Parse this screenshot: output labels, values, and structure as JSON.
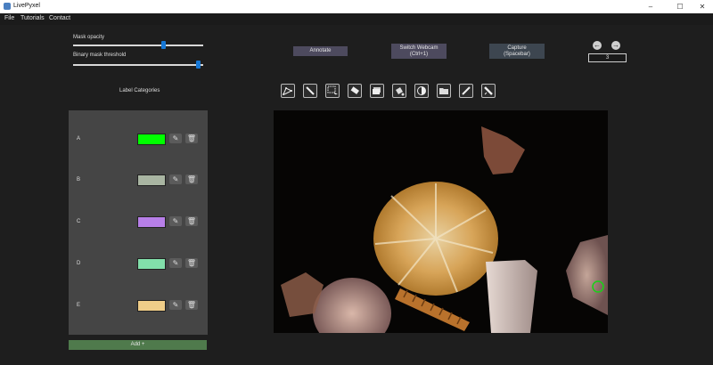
{
  "window": {
    "title": "LivePyxel",
    "min": "–",
    "max": "☐",
    "close": "✕"
  },
  "menu": [
    "File",
    "Tutorials",
    "Contact"
  ],
  "sliders": [
    {
      "label": "Mask opacity",
      "value": 0.7
    },
    {
      "label": "Binary mask threshold",
      "value": 0.98
    }
  ],
  "buttons": {
    "annotate": "Annotate",
    "switch_webcam_line1": "Switch Webcam",
    "switch_webcam_line2": "(Ctrl+1)",
    "capture_line1": "Capture",
    "capture_line2": "(Spacebar)",
    "add": "Add +"
  },
  "counter": {
    "value": "3"
  },
  "label_categories": {
    "title": "Label Categories",
    "items": [
      {
        "name": "A",
        "color": "#00ff00"
      },
      {
        "name": "B",
        "color": "#a9b5a2"
      },
      {
        "name": "C",
        "color": "#b77fe8"
      },
      {
        "name": "D",
        "color": "#82dfaa"
      },
      {
        "name": "E",
        "color": "#efcd88"
      }
    ]
  },
  "tools": [
    "polygon-icon",
    "brush-icon",
    "select-cursor-icon",
    "eraser-icon",
    "layers-icon",
    "bucket-icon",
    "contrast-icon",
    "folder-icon",
    "pen-icon",
    "slash-brush-icon"
  ],
  "colors": {
    "accent": "#1778d6",
    "add_button": "#4f7a4c",
    "panel": "#454545",
    "background": "#1e1e1e"
  }
}
